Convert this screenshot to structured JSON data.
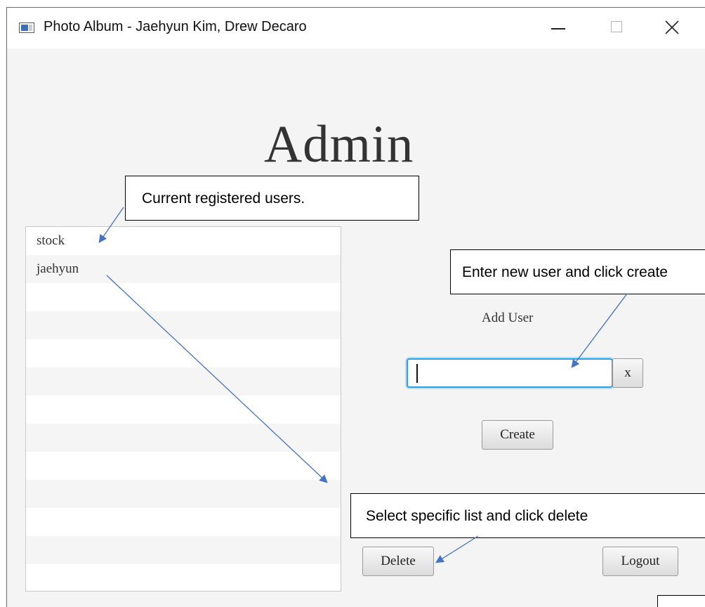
{
  "window": {
    "title": "Photo Album - Jaehyun Kim, Drew Decaro"
  },
  "main": {
    "heading": "Admin",
    "users": [
      "stock",
      "jaehyun",
      "",
      "",
      "",
      "",
      "",
      "",
      "",
      "",
      "",
      "",
      ""
    ],
    "add_user_label": "Add User",
    "new_user_value": "",
    "clear_button": "x",
    "create_button": "Create",
    "delete_button": "Delete",
    "logout_button": "Logout"
  },
  "annotations": {
    "users_note": "Current registered users.",
    "create_note": "Enter new user and click create",
    "delete_note": "Select specific list and click delete",
    "arrow_color": "#4472c4"
  },
  "icons": {
    "app": "app-window-icon",
    "minimize": "minimize-icon",
    "maximize": "maximize-icon",
    "close": "close-icon"
  }
}
